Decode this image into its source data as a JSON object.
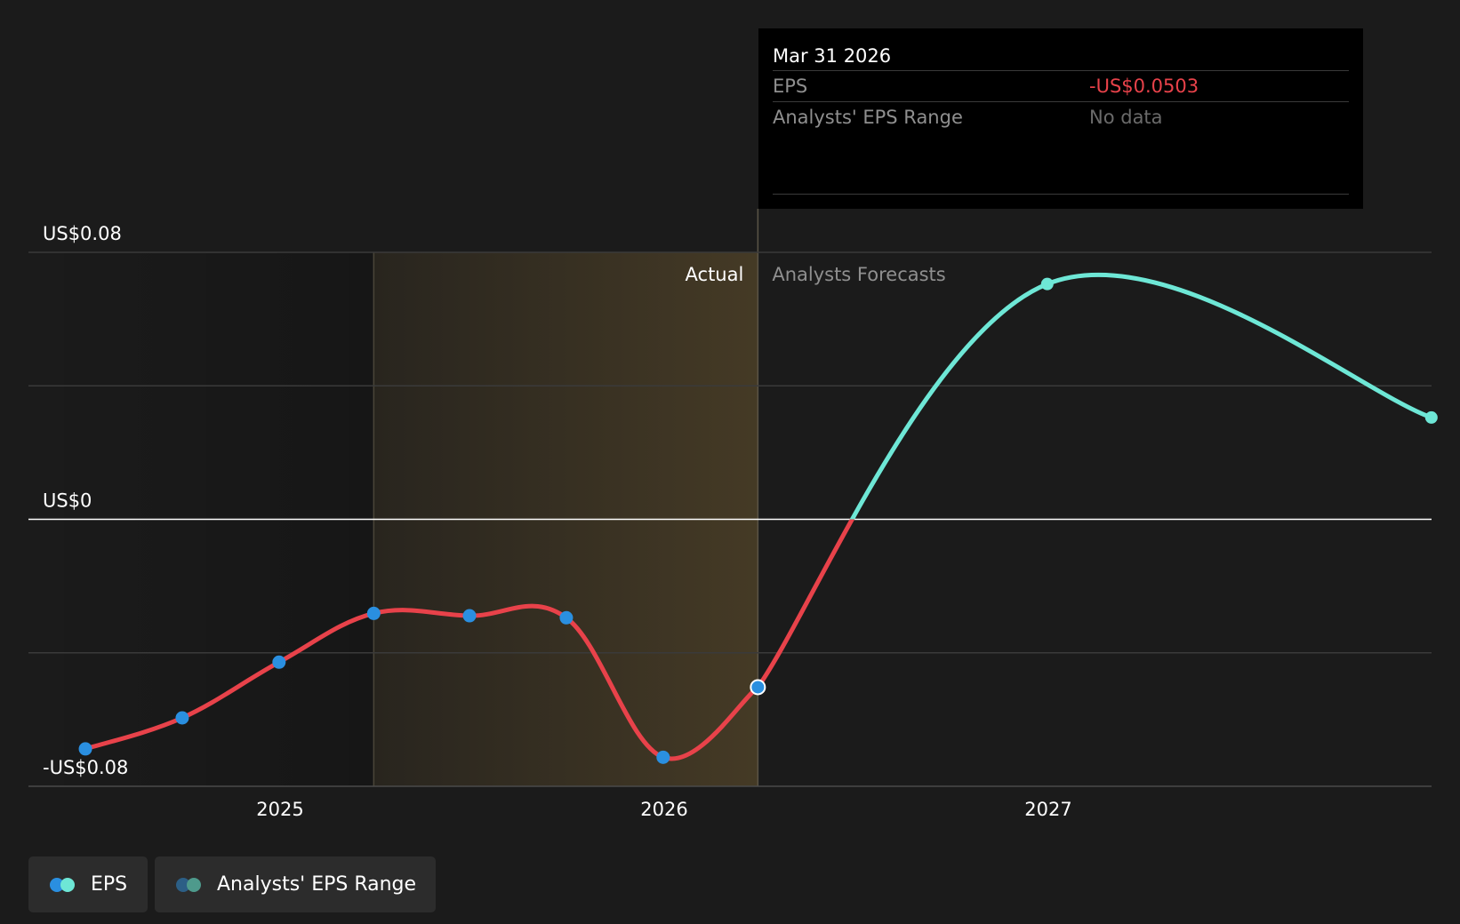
{
  "chart_data": {
    "type": "line",
    "y_axis": {
      "labels": [
        "US$0.08",
        "US$0",
        "-US$0.08"
      ],
      "ylim": [
        -0.08,
        0.08
      ],
      "grid": true
    },
    "x_axis": {
      "tick_labels": [
        "2025",
        "2026",
        "2027"
      ]
    },
    "regions": {
      "actual_label": "Actual",
      "forecast_label": "Analysts Forecasts"
    },
    "series": [
      {
        "name": "EPS",
        "role": "actual",
        "color_positive": "#6ee7d6",
        "color_negative": "#e8424a",
        "marker_color": "#2a8fe0",
        "points": [
          {
            "x": "2024-06-30",
            "y": -0.0688
          },
          {
            "x": "2024-09-30",
            "y": -0.0595
          },
          {
            "x": "2024-12-31",
            "y": -0.0428
          },
          {
            "x": "2025-03-31",
            "y": -0.0282
          },
          {
            "x": "2025-06-30",
            "y": -0.0289
          },
          {
            "x": "2025-09-30",
            "y": -0.0295
          },
          {
            "x": "2025-12-31",
            "y": -0.0713
          },
          {
            "x": "2026-03-31",
            "y": -0.0503
          }
        ]
      },
      {
        "name": "EPS",
        "role": "forecast",
        "color_positive": "#6ee7d6",
        "color_negative": "#e8424a",
        "points": [
          {
            "x": "2026-03-31",
            "y": -0.0503
          },
          {
            "x": "2026-12-31",
            "y": 0.0705
          },
          {
            "x": "2027-12-31",
            "y": 0.0305
          }
        ]
      }
    ]
  },
  "tooltip": {
    "date": "Mar 31 2026",
    "rows": [
      {
        "label": "EPS",
        "value": "-US$0.0503"
      },
      {
        "label": "Analysts' EPS Range",
        "value": "No data"
      }
    ]
  },
  "legend": [
    {
      "label": "EPS",
      "colors": [
        "#2a8fe0",
        "#6ee7d6"
      ]
    },
    {
      "label": "Analysts' EPS Range",
      "colors": [
        "#2c5f86",
        "#4e9a8c"
      ]
    }
  ],
  "colors": {
    "background": "#1b1b1b",
    "gridline": "#3a3a3a",
    "zero_line": "#ffffff",
    "shade": "#d9a84a",
    "tooltip_bg": "#000000"
  }
}
